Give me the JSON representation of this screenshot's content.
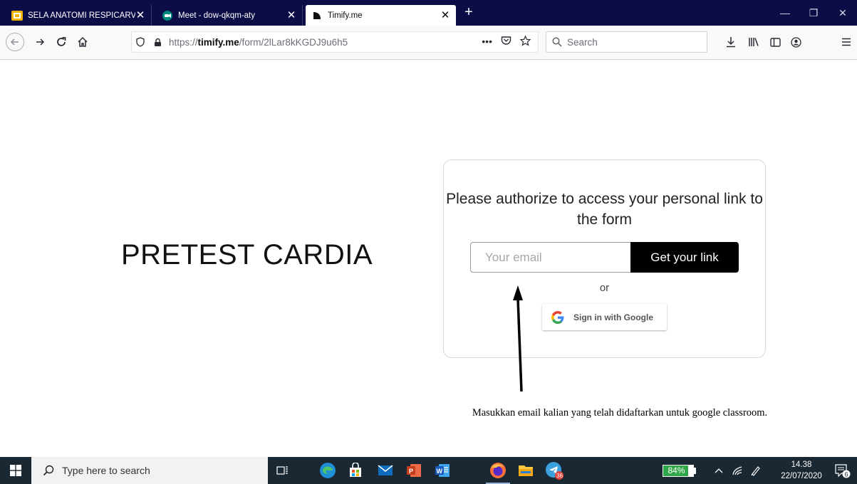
{
  "browser": {
    "tabs": [
      {
        "title": "SELA ANATOMI RESPICARVAS I",
        "icon": "presentation-icon",
        "active": false
      },
      {
        "title": "Meet - dow-qkqm-aty",
        "icon": "meet-icon",
        "active": false
      },
      {
        "title": "Timify.me",
        "icon": "timify-icon",
        "active": true
      }
    ],
    "url": {
      "protocol": "https://",
      "host": "timify.me",
      "path": "/form/2lLar8kKGDJ9u6h5"
    },
    "search_placeholder": "Search"
  },
  "page": {
    "form_title": "PRETEST CARDIA",
    "card": {
      "heading": "Please authorize to access your personal link to the form",
      "email_placeholder": "Your email",
      "email_value": "",
      "submit_label": "Get your link",
      "or_text": "or",
      "google_label": "Sign in with Google"
    },
    "annotation": "Masukkan email kalian yang telah didaftarkan untuk google classroom."
  },
  "taskbar": {
    "search_placeholder": "Type here to search",
    "battery_percent": "84%",
    "battery_level": 84,
    "time": "14.38",
    "date": "22/07/2020",
    "notification_count": "6",
    "telegram_badge": "36"
  },
  "colors": {
    "tabbar_bg": "#0c0c47",
    "taskbar_bg": "#1a2833",
    "button_black": "#000000",
    "battery_green": "#2fa64a",
    "google_blue": "#4285F4",
    "google_red": "#EA4335",
    "google_yellow": "#FBBC05",
    "google_green": "#34A853"
  }
}
